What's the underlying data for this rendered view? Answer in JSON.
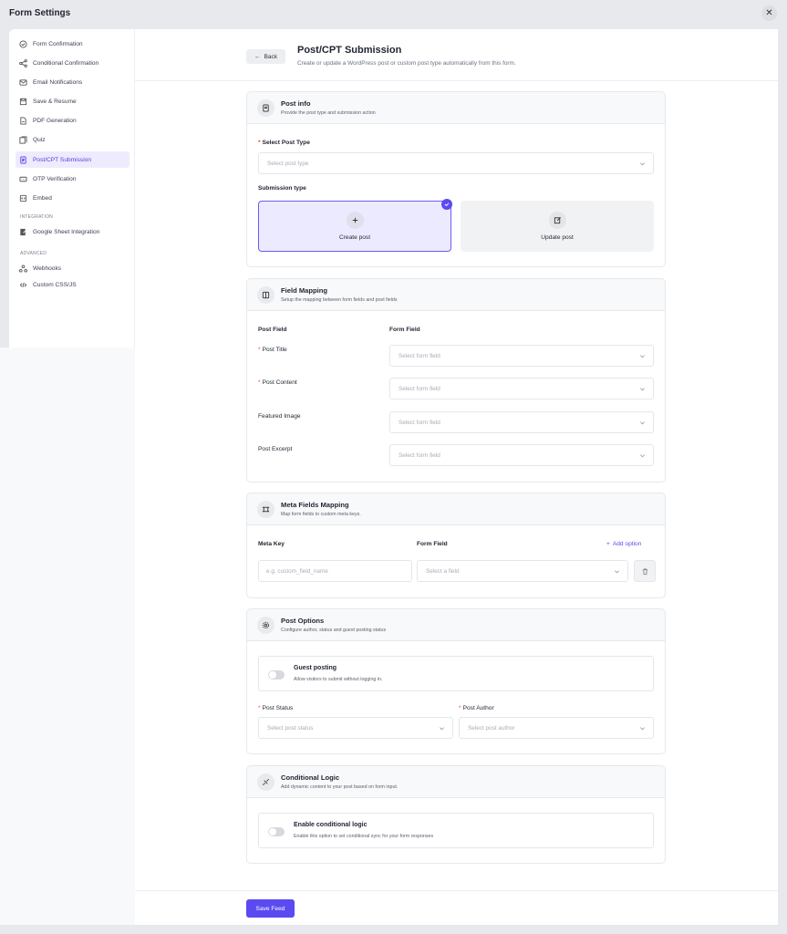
{
  "app": {
    "title": "Form Settings",
    "close_icon": "close-icon"
  },
  "sidebar": {
    "items": [
      {
        "label": "Form Confirmation",
        "icon": "check-circle-icon"
      },
      {
        "label": "Conditional Confirmation",
        "icon": "branch-icon"
      },
      {
        "label": "Email Notifications",
        "icon": "mail-icon"
      },
      {
        "label": "Save & Resume",
        "icon": "save-icon"
      },
      {
        "label": "PDF Generation",
        "icon": "pdf-icon"
      },
      {
        "label": "Quiz",
        "icon": "quiz-icon"
      },
      {
        "label": "Post/CPT Submission",
        "icon": "document-icon",
        "active": true
      },
      {
        "label": "OTP Verification",
        "icon": "otp-icon"
      },
      {
        "label": "Embed",
        "icon": "embed-icon"
      }
    ],
    "integration_label": "INTEGRATION",
    "integration_items": [
      {
        "label": "Google Sheet Integration",
        "icon": "sheet-icon"
      }
    ],
    "advanced_label": "ADVANCED",
    "advanced_items": [
      {
        "label": "Webhooks",
        "icon": "webhook-icon"
      },
      {
        "label": "Custom CSS/JS",
        "icon": "code-icon"
      }
    ]
  },
  "header": {
    "back_label": "Back",
    "title": "Post/CPT Submission",
    "subtitle": "Create or update a WordPress post or custom post type automatically from this form."
  },
  "post_info": {
    "title": "Post info",
    "subtitle": "Provide the post type and submission action",
    "post_type_label": "Select Post Type",
    "post_type_placeholder": "Select post type",
    "submission_type_label": "Submission type",
    "create_label": "Create post",
    "update_label": "Update post"
  },
  "field_mapping": {
    "title": "Field Mapping",
    "subtitle": "Setup the mapping between form fields and post fields",
    "col_post_field": "Post Field",
    "col_form_field": "Form Field",
    "rows": [
      {
        "label": "Post Title",
        "required": true,
        "placeholder": "Select form field"
      },
      {
        "label": "Post Content",
        "required": true,
        "placeholder": "Select form field"
      },
      {
        "label": "Featured Image",
        "required": false,
        "placeholder": "Select form field"
      },
      {
        "label": "Post Excerpt",
        "required": false,
        "placeholder": "Select form field"
      }
    ]
  },
  "meta_fields": {
    "title": "Meta Fields Mapping",
    "subtitle": "Map form fields to custom meta keys.",
    "col_meta_key": "Meta Key",
    "col_form_field": "Form Field",
    "add_option": "Add option",
    "meta_key_placeholder": "e.g. custom_field_name",
    "field_placeholder": "Select a field"
  },
  "post_options": {
    "title": "Post Options",
    "subtitle": "Configure author, status and guest posting status",
    "guest_title": "Guest posting",
    "guest_sub": "Allow visitors to submit without logging in.",
    "status_label": "Post Status",
    "status_placeholder": "Select post status",
    "author_label": "Post Author",
    "author_placeholder": "Select post author"
  },
  "conditional": {
    "title": "Conditional Logic",
    "subtitle": "Add dynamic content to your post based on form input.",
    "toggle_title": "Enable conditional logic",
    "toggle_sub": "Enable this option to set conditional sync for your form responses"
  },
  "footer": {
    "save_label": "Save Feed"
  },
  "colors": {
    "accent": "#5b4af0",
    "required": "#e5484d"
  }
}
